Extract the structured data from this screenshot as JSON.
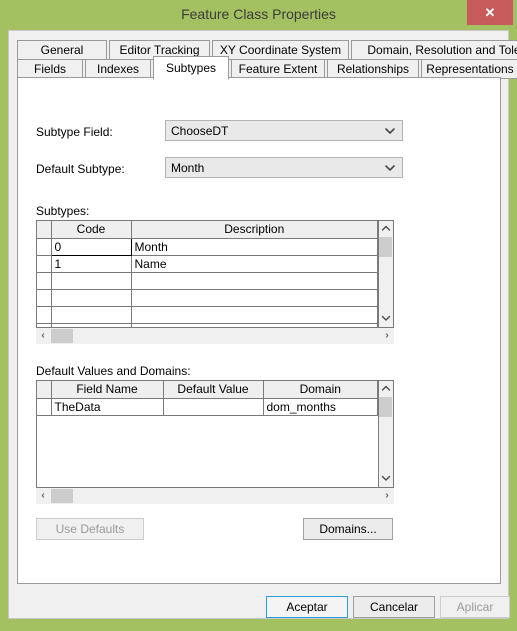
{
  "window": {
    "title": "Feature Class Properties",
    "close_label": "✕",
    "accent_green": "#a4c162",
    "close_red": "#c75b5b"
  },
  "tabs": {
    "row1": [
      {
        "label": "General",
        "active": false
      },
      {
        "label": "Editor Tracking",
        "active": false
      },
      {
        "label": "XY Coordinate System",
        "active": false
      },
      {
        "label": "Domain, Resolution and Tolerance",
        "active": false
      }
    ],
    "row2": [
      {
        "label": "Fields",
        "active": false
      },
      {
        "label": "Indexes",
        "active": false
      },
      {
        "label": "Subtypes",
        "active": true
      },
      {
        "label": "Feature Extent",
        "active": false
      },
      {
        "label": "Relationships",
        "active": false
      },
      {
        "label": "Representations",
        "active": false
      }
    ]
  },
  "form": {
    "subtype_field_label": "Subtype Field:",
    "subtype_field_value": "ChooseDT",
    "default_subtype_label": "Default Subtype:",
    "default_subtype_value": "Month",
    "chevron_icon": "chevron-down-icon"
  },
  "subtypes_section": {
    "label": "Subtypes:",
    "columns": [
      "Code",
      "Description"
    ],
    "rows": [
      {
        "code": "0",
        "description": "Month",
        "selected": true
      },
      {
        "code": "1",
        "description": "Name",
        "selected": false
      },
      {
        "code": "",
        "description": "",
        "selected": false
      },
      {
        "code": "",
        "description": "",
        "selected": false
      },
      {
        "code": "",
        "description": "",
        "selected": false
      },
      {
        "code": "",
        "description": "",
        "selected": false
      }
    ],
    "scroll_up_icon": "chevron-up-icon",
    "scroll_down_icon": "chevron-down-icon",
    "scroll_left_icon": "‹",
    "scroll_right_icon": "›"
  },
  "domains_section": {
    "label": "Default Values and Domains:",
    "columns": [
      "Field Name",
      "Default Value",
      "Domain"
    ],
    "rows": [
      {
        "field_name": "TheData",
        "default_value": "",
        "domain": "dom_months"
      }
    ],
    "empty_rows": 5,
    "scroll_up_icon": "chevron-up-icon",
    "scroll_down_icon": "chevron-down-icon",
    "scroll_left_icon": "‹",
    "scroll_right_icon": "›"
  },
  "actions": {
    "use_defaults_label": "Use Defaults",
    "use_defaults_enabled": false,
    "domains_label": "Domains..."
  },
  "footer": {
    "ok_label": "Aceptar",
    "cancel_label": "Cancelar",
    "apply_label": "Aplicar",
    "apply_enabled": false
  }
}
